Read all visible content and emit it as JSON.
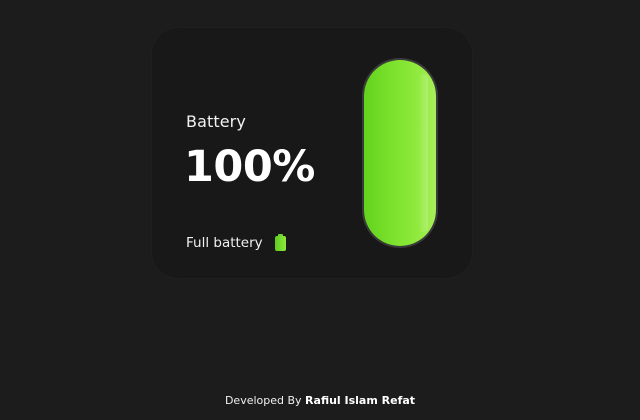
{
  "card": {
    "title": "Battery",
    "percent_label": "100%",
    "level": 1.0,
    "status_text": "Full battery",
    "status_icon": "battery-full-icon"
  },
  "colors": {
    "background": "#1c1c1c",
    "card": "#181818",
    "charge_green": "#79e02b"
  },
  "footer": {
    "prefix": "Developed By",
    "author": "Rafiul Islam Refat"
  }
}
